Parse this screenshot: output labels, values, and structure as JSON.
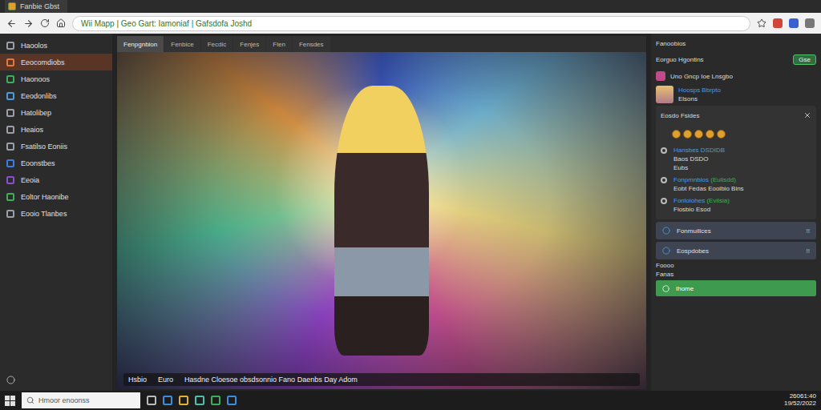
{
  "browser": {
    "tab_title": "Fanbie Gbst",
    "url": "Wii Mapp | Geo Gart: Iamoniaf | Gafsdofa Joshd"
  },
  "sidebar": {
    "items": [
      {
        "label": "Haoolos",
        "selected": false,
        "color": "#9aa0a6"
      },
      {
        "label": "Eeocomdiobs",
        "selected": true,
        "color": "#e07a3a"
      },
      {
        "label": "Haonoos",
        "selected": false,
        "color": "#3fae5a"
      },
      {
        "label": "Eeodonlibs",
        "selected": false,
        "color": "#4a9be0"
      },
      {
        "label": "Hatolibep",
        "selected": false,
        "color": "#9aa0a6"
      },
      {
        "label": "Heaios",
        "selected": false,
        "color": "#9aa0a6"
      },
      {
        "label": "Fsatilso Eoniis",
        "selected": false,
        "color": "#9aa0a6"
      },
      {
        "label": "Eoonstbes",
        "selected": false,
        "color": "#3b7de0"
      },
      {
        "label": "Eeoia",
        "selected": false,
        "color": "#8a4fd0"
      },
      {
        "label": "Eoltor Haonibe",
        "selected": false,
        "color": "#3fae5a"
      },
      {
        "label": "Eooio Tlanbes",
        "selected": false,
        "color": "#9aa0a6"
      }
    ]
  },
  "content_tabs": [
    {
      "label": "Fenpgnbion",
      "selected": true
    },
    {
      "label": "Fenbice",
      "selected": false
    },
    {
      "label": "Fecdic",
      "selected": false
    },
    {
      "label": "Fenjes",
      "selected": false
    },
    {
      "label": "Flen",
      "selected": false
    },
    {
      "label": "Fensdes",
      "selected": false
    }
  ],
  "caption": [
    "Hsbio",
    "Euro",
    "Hasdne Cloesoe obsdsonnio Fano Daenbs Day Adom"
  ],
  "right_panel": {
    "title": "Fanoobios",
    "toggle_row": {
      "label": "Eorguo Hgontins",
      "button": "Gse",
      "on": true
    },
    "link": "Uno Gncp Ioe Lnsgbo",
    "profile": {
      "name": "Hoosps Bbrpto",
      "sub": "Elsons"
    },
    "section_title": "Eosdo Fsides",
    "entries": [
      {
        "title": "Hansbes",
        "tag": "DSDIDB",
        "tag_color": "#4a9be0",
        "lines": [
          "Baos DSDO",
          "Eubs"
        ]
      },
      {
        "title": "Fonpmnbios",
        "tag": "(Eulisdd)",
        "tag_color": "#3fae5a",
        "lines": [
          "Eobt Fedas Eooibio Bins"
        ]
      },
      {
        "title": "Fonloiohes",
        "tag": "(Evilsia)",
        "tag_color": "#3fae5a",
        "lines": [
          "Fiosbio Esod"
        ]
      }
    ],
    "cards": [
      {
        "label": "Fonmuilices",
        "badge": "!!"
      },
      {
        "label": "Eospdobes",
        "badge": "!!"
      }
    ],
    "footer": [
      "Foooo",
      "Fanas"
    ],
    "home_bar": "Ihome"
  },
  "taskbar": {
    "search_placeholder": "Hmoor enoonss",
    "time": "26061:40",
    "date": "19/52/2022"
  }
}
